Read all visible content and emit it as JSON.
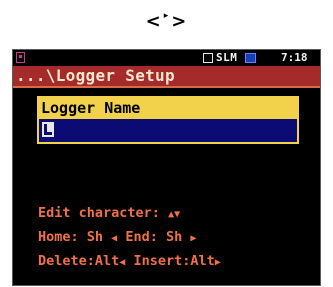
{
  "nav_hint": {
    "left_symbol": "<",
    "play_symbol": "▸",
    "right_symbol": ">"
  },
  "status_bar": {
    "mode": "SLM",
    "clock": "7:18"
  },
  "title": "...\\Logger Setup",
  "logger_name": {
    "label": "Logger Name",
    "value": ""
  },
  "help": {
    "edit_character": "Edit character:",
    "home": "Home: Sh",
    "end": "End: Sh",
    "delete": "Delete:Alt",
    "insert": "Insert:Alt"
  },
  "icons": [
    "instrument-icon",
    "mode-box-icon",
    "battery-icon",
    "cursor-icon",
    "up-arrow-icon",
    "down-arrow-icon",
    "left-arrow-icon",
    "right-arrow-icon"
  ],
  "colors": {
    "title_bar": "#a52a2a",
    "title_text": "#f6e6cf",
    "field_label_bg": "#f2d24a",
    "field_input_bg": "#0b0b73",
    "help_text": "#f07048",
    "screen_bg": "#000000"
  }
}
